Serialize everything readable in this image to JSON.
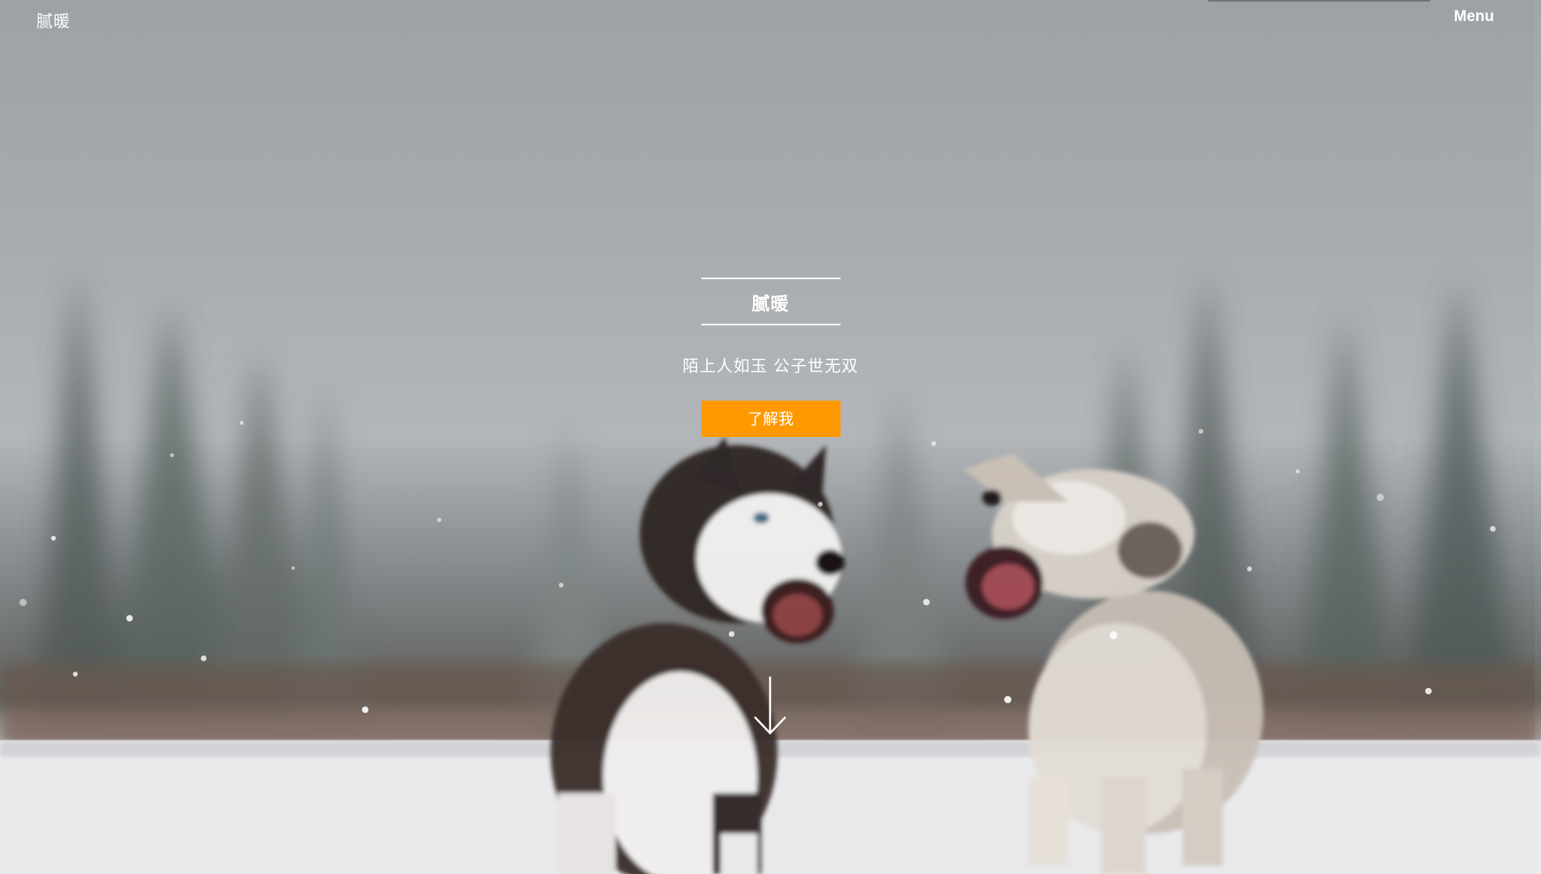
{
  "header": {
    "logo_text": "腻暖",
    "menu_label": "Menu"
  },
  "hero": {
    "title": "腻暖",
    "subtitle": "陌上人如玉 公子世无双",
    "button_label": "了解我"
  },
  "icons": {
    "scroll_down": "arrow-down-icon"
  },
  "colors": {
    "accent": "#ff9900",
    "text": "#ffffff"
  }
}
